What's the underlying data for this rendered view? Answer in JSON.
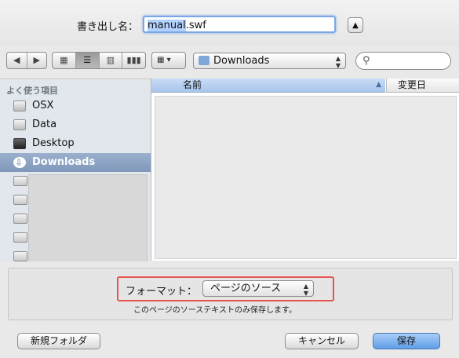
{
  "save_as": {
    "label": "書き出し名：",
    "filename_selected": "manual",
    "filename_rest": ".swf",
    "expand_icon": "▲"
  },
  "toolbar": {
    "back_icon": "◀",
    "forward_icon": "▶",
    "view_icons": [
      "▦",
      "☰",
      "▥",
      "▮▮▮"
    ],
    "arrange_icon": "▦ ▾",
    "location": "Downloads",
    "location_arrows": "▲\n▼",
    "search_icon": "⚲"
  },
  "sidebar": {
    "heading": "よく使う項目",
    "items": [
      {
        "label": "OSX",
        "selected": false
      },
      {
        "label": "Data",
        "selected": false
      },
      {
        "label": "Desktop",
        "selected": false
      },
      {
        "label": "Downloads",
        "selected": true
      }
    ]
  },
  "filelist": {
    "col_name": "名前",
    "col_date": "変更日",
    "sort_icon": "▲"
  },
  "format": {
    "label": "フォーマット：",
    "value": "ページのソース",
    "arrows": "▲\n▼",
    "description": "このページのソーステキストのみ保存します。"
  },
  "buttons": {
    "new_folder": "新規フォルダ",
    "cancel": "キャンセル",
    "save": "保存"
  }
}
